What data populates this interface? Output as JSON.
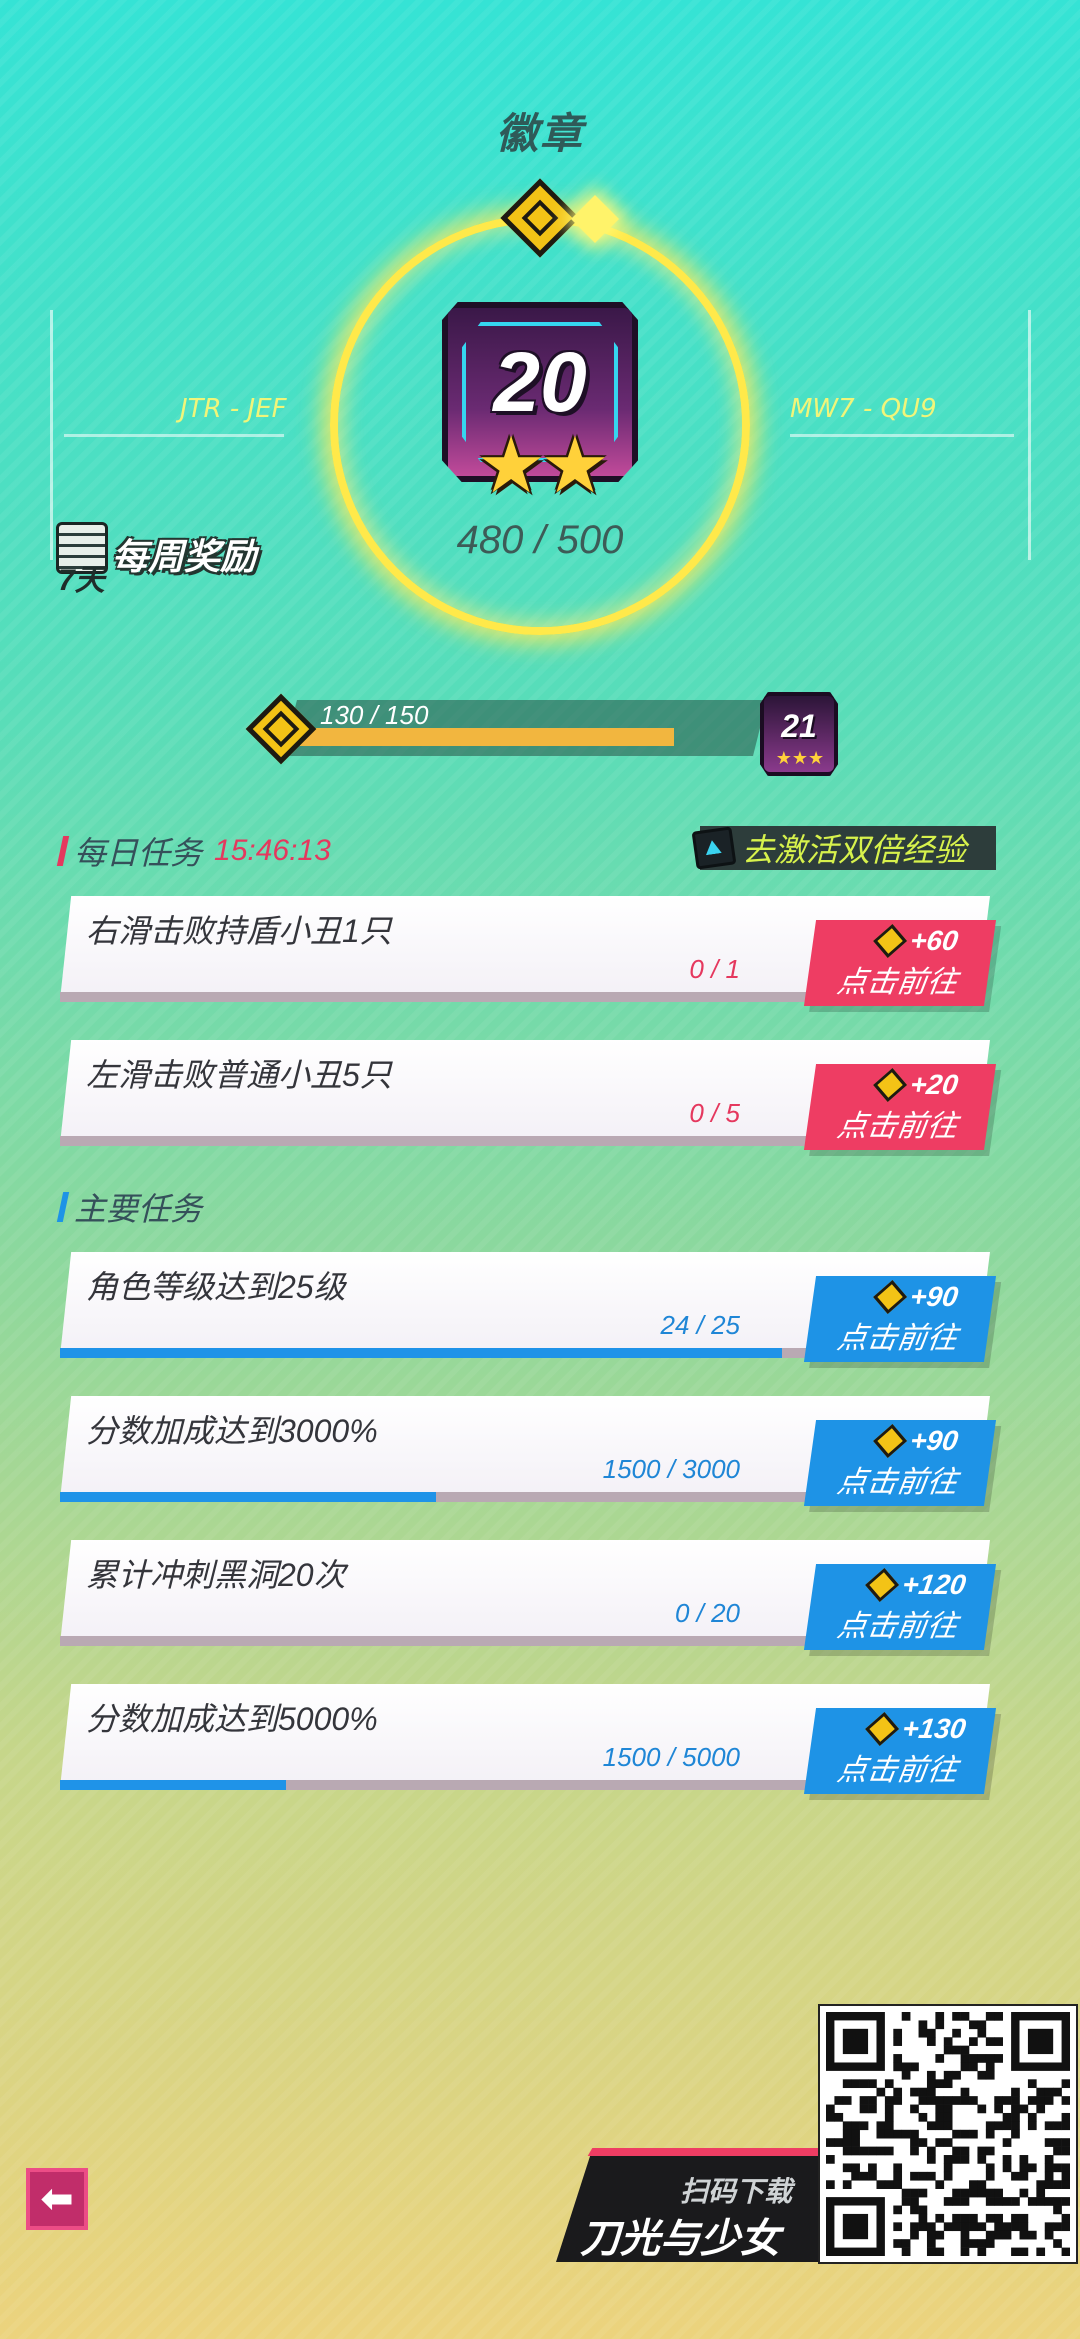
{
  "page": {
    "title": "徽章"
  },
  "badge": {
    "level": "20",
    "stars": "★★",
    "progress": "480 / 500",
    "left_code": "JTR - JEF",
    "right_code": "MW7 - QU9"
  },
  "weekly_reward": {
    "days": "7天",
    "label": "每周奖励"
  },
  "level_bar": {
    "progress_text": "130 / 150",
    "fill_fraction": 0.87,
    "next_level": "21",
    "next_stars": "★★★"
  },
  "daily": {
    "header": "每日任务",
    "timer": "15:46:13",
    "double_xp_label": "去激活双倍经验",
    "tasks": [
      {
        "name": "右滑击败持盾小丑1只",
        "count": "0 / 1",
        "reward": "+60",
        "action": "点击前往",
        "progress": 0.0
      },
      {
        "name": "左滑击败普通小丑5只",
        "count": "0 / 5",
        "reward": "+20",
        "action": "点击前往",
        "progress": 0.0
      }
    ]
  },
  "main": {
    "header": "主要任务",
    "tasks": [
      {
        "name": "角色等级达到25级",
        "count": "24 / 25",
        "reward": "+90",
        "action": "点击前往",
        "progress": 0.96
      },
      {
        "name": "分数加成达到3000%",
        "count": "1500 / 3000",
        "reward": "+90",
        "action": "点击前往",
        "progress": 0.5
      },
      {
        "name": "累计冲刺黑洞20次",
        "count": "0 / 20",
        "reward": "+120",
        "action": "点击前往",
        "progress": 0.0
      },
      {
        "name": "分数加成达到5000%",
        "count": "1500 / 5000",
        "reward": "+130",
        "action": "点击前往",
        "progress": 0.3
      }
    ]
  },
  "footer": {
    "back_icon": "back-arrow-icon",
    "promo_small": "扫码下载",
    "promo_big": "刀光与少女"
  },
  "colors": {
    "daily_accent": "#ee3d63",
    "main_accent": "#1e93e6",
    "gold": "#f3c316"
  }
}
